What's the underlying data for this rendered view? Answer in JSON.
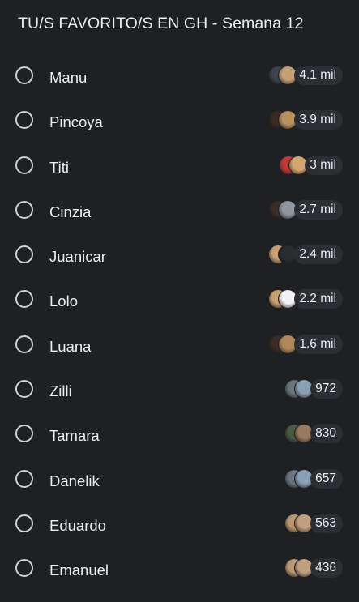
{
  "poll": {
    "title": "TU/S FAVORITO/S EN GH - Semana 12",
    "options": [
      {
        "label": "Manu",
        "votes": "4.1 mil",
        "avatars": [
          "#3b4250",
          "#c4a078"
        ]
      },
      {
        "label": "Pincoya",
        "votes": "3.9 mil",
        "avatars": [
          "#3a2a22",
          "#b89060"
        ]
      },
      {
        "label": "Titi",
        "votes": "3 mil",
        "avatars": [
          "#c03a3a",
          "#d6a670"
        ]
      },
      {
        "label": "Cinzia",
        "votes": "2.7 mil",
        "avatars": [
          "#3a2c26",
          "#8e959c"
        ]
      },
      {
        "label": "Juanicar",
        "votes": "2.4 mil",
        "avatars": [
          "#c8a072",
          "#2a2c30"
        ]
      },
      {
        "label": "Lolo",
        "votes": "2.2 mil",
        "avatars": [
          "#c8a072",
          "#f2f2f2"
        ]
      },
      {
        "label": "Luana",
        "votes": "1.6 mil",
        "avatars": [
          "#3a2c26",
          "#b0885a"
        ]
      },
      {
        "label": "Zilli",
        "votes": "972",
        "avatars": [
          "#6a737c",
          "#8aa0b6"
        ]
      },
      {
        "label": "Tamara",
        "votes": "830",
        "avatars": [
          "#4a5a44",
          "#9a7a60"
        ]
      },
      {
        "label": "Danelik",
        "votes": "657",
        "avatars": [
          "#6a737c",
          "#8aa0b6"
        ]
      },
      {
        "label": "Eduardo",
        "votes": "563",
        "avatars": [
          "#b89870",
          "#c0a080"
        ]
      },
      {
        "label": "Emanuel",
        "votes": "436",
        "avatars": [
          "#b89870",
          "#c0a080"
        ]
      }
    ]
  }
}
